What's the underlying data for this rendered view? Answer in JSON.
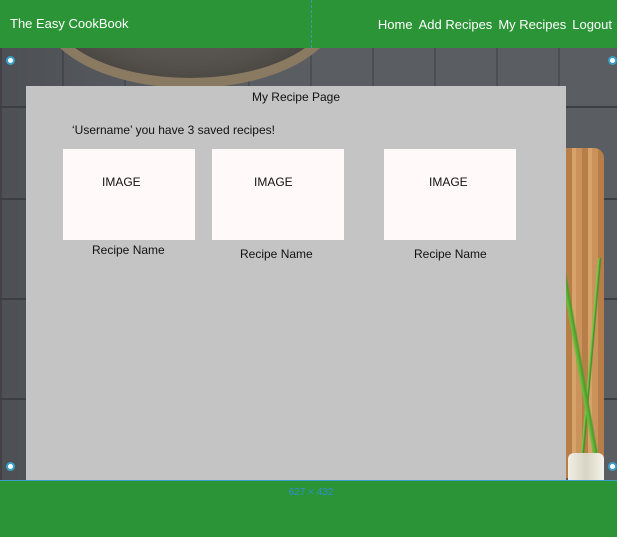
{
  "header": {
    "brand": "The Easy CookBook",
    "nav": [
      "Home",
      "Add Recipes",
      "My Recipes",
      "Logout"
    ]
  },
  "main": {
    "page_title": "My Recipe Page",
    "saved_message": "‘Username’ you have 3 saved recipes!",
    "recipes": [
      {
        "image_label": "IMAGE",
        "name": "Recipe Name"
      },
      {
        "image_label": "IMAGE",
        "name": "Recipe Name"
      },
      {
        "image_label": "IMAGE",
        "name": "Recipe Name"
      }
    ]
  },
  "overlay": {
    "dimensions_label": "627 × 432"
  },
  "colors": {
    "header_green": "#2a9436",
    "panel_grey": "#c4c4c4",
    "image_placeholder": "#fffaf9",
    "selection_blue": "#3aa0c8"
  }
}
